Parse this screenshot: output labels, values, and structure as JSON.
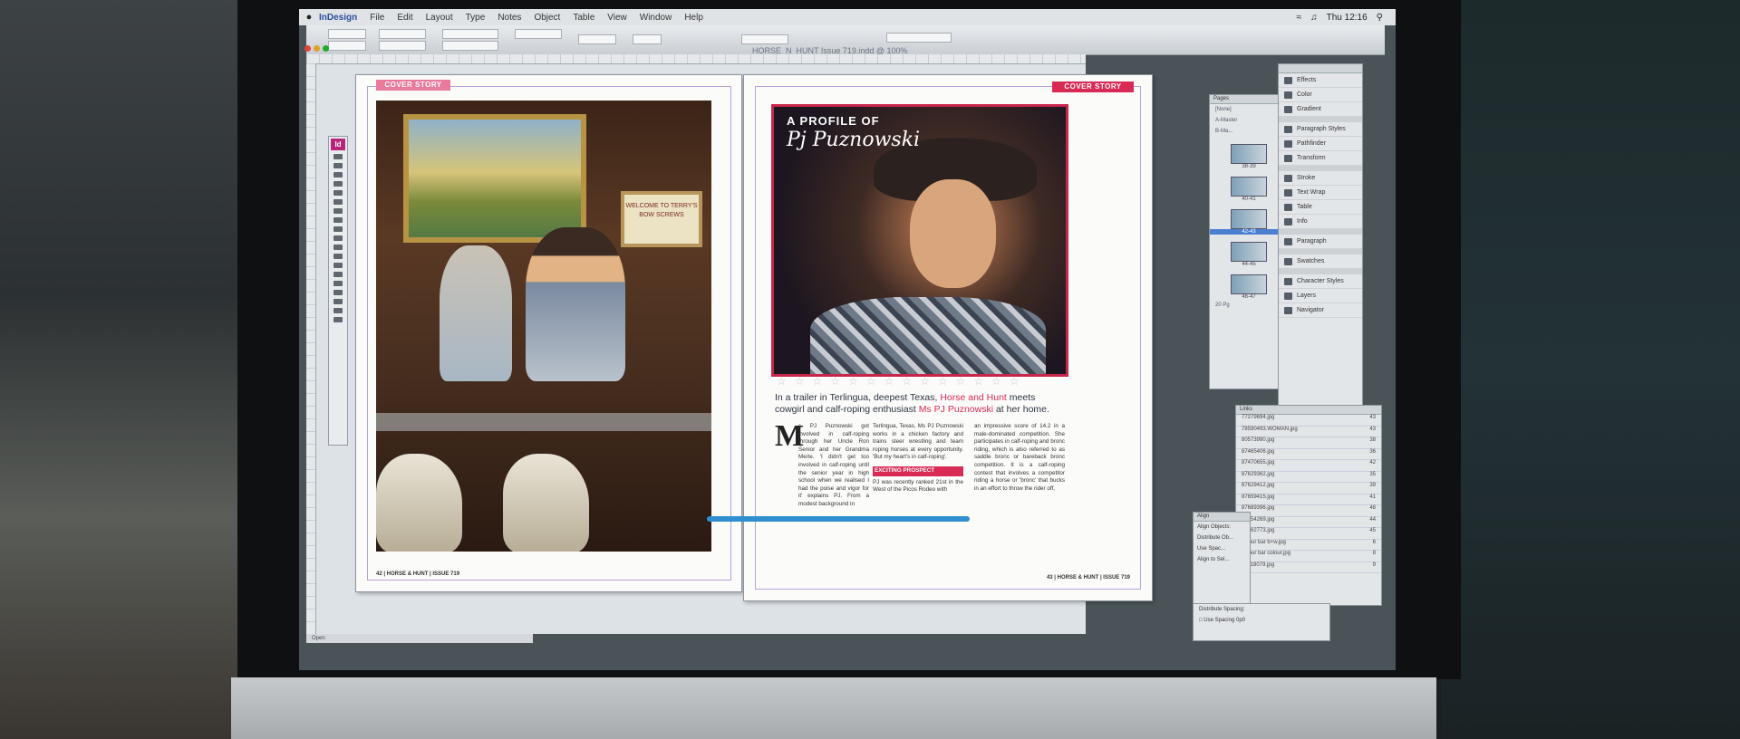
{
  "menubar": {
    "app_name": "InDesign",
    "items": [
      "File",
      "Edit",
      "Layout",
      "Type",
      "Notes",
      "Object",
      "Table",
      "View",
      "Window",
      "Help"
    ],
    "clock": "Thu 12:16"
  },
  "document": {
    "title": "HORSE_N_HUNT Issue 719.indd @ 100%"
  },
  "left_page": {
    "section_tag": "COVER STORY",
    "sign_text": "WELCOME TO TERRY'S BOW SCREWS",
    "folio": "42 | HORSE & HUNT | ISSUE 719"
  },
  "right_page": {
    "section_tag": "COVER STORY",
    "profile_prefix": "A PROFILE OF",
    "profile_name": "Pj Puznowski",
    "intro_1": "In a trailer in Terlingua, deepest Texas, ",
    "intro_brand": "Horse and Hunt",
    "intro_2": " meets cowgirl and calf-roping enthusiast ",
    "intro_name": "Ms PJ Puznowski",
    "intro_3": " at her home.",
    "dropcap": "M",
    "col1": "s PJ Puznowski got involved in calf-roping through her Uncle Ron Senior and her Grandma Merle. 'I didn't get too involved in calf-roping until the senior year in high school when we realised I had the poise and vigor for it' explains PJ. From a modest background in",
    "col2": "Terlingua, Texas, Ms PJ Puznowski works in a chicken factory and trains steer wrestling and team roping horses at every opportunity. 'But my heart's in calf-roping'.",
    "subhead": "EXCITING PROSPECT",
    "col2b": "PJ was recently ranked 21st in the West of the Picos Rodeo with",
    "col3": "an impressive score of 14.2 in a male-dominated competition. She participates in calf-roping and bronc riding, which is also referred to as saddle bronc or bareback bronc competition. It is a calf-roping contest that involves a competitor riding a horse or 'bronc' that bucks in an effort to throw the rider off,",
    "folio": "43 | HORSE & HUNT | ISSUE 719"
  },
  "pages_panel": {
    "header": "Pages",
    "rows": [
      "[None]",
      "A-Master",
      "B-Ma..."
    ],
    "thumbs": [
      "38-39",
      "40-41",
      "42-43",
      "44-45",
      "46-47"
    ],
    "selected": "42-43",
    "footer": "20 Pg"
  },
  "panel_list": {
    "group1": [
      "Effects",
      "Color",
      "Gradient"
    ],
    "group2": [
      "Paragraph Styles",
      "Pathfinder",
      "Transform"
    ],
    "group3": [
      "Stroke",
      "Text Wrap",
      "Table",
      "Info"
    ],
    "group4": [
      "Paragraph"
    ],
    "group5": [
      "Swatches"
    ],
    "group6": [
      "Character Styles",
      "Layers",
      "Navigator"
    ]
  },
  "links_panel": {
    "header": "Links",
    "rows": [
      {
        "name": "77279694.jpg",
        "page": "43"
      },
      {
        "name": "78590493.WOMAN.jpg",
        "page": "43"
      },
      {
        "name": "80573990.jpg",
        "page": "38"
      },
      {
        "name": "87465406.jpg",
        "page": "36"
      },
      {
        "name": "87470655.jpg",
        "page": "42"
      },
      {
        "name": "87629362.jpg",
        "page": "35"
      },
      {
        "name": "87629412.jpg",
        "page": "39"
      },
      {
        "name": "87659415.jpg",
        "page": "41"
      },
      {
        "name": "87689396.jpg",
        "page": "48"
      },
      {
        "name": "87754269.jpg",
        "page": "44"
      },
      {
        "name": "87762773.jpg",
        "page": "45"
      },
      {
        "name": "colour bar b+w.jpg",
        "page": "6"
      },
      {
        "name": "colour bar colour.jpg",
        "page": "8"
      },
      {
        "name": "dv818079.jpg",
        "page": "9"
      }
    ]
  },
  "align_panel": {
    "header": "Align",
    "title": "Align Objects:",
    "distribute": "Distribute Ob...",
    "use_spacing": "Use Spac...",
    "align_to": "Align to Sel..."
  },
  "distribute_panel": {
    "title": "Distribute Spacing:",
    "use_spacing": "Use Spacing",
    "value": "0p0"
  },
  "statusbar": {
    "text": "Open"
  }
}
